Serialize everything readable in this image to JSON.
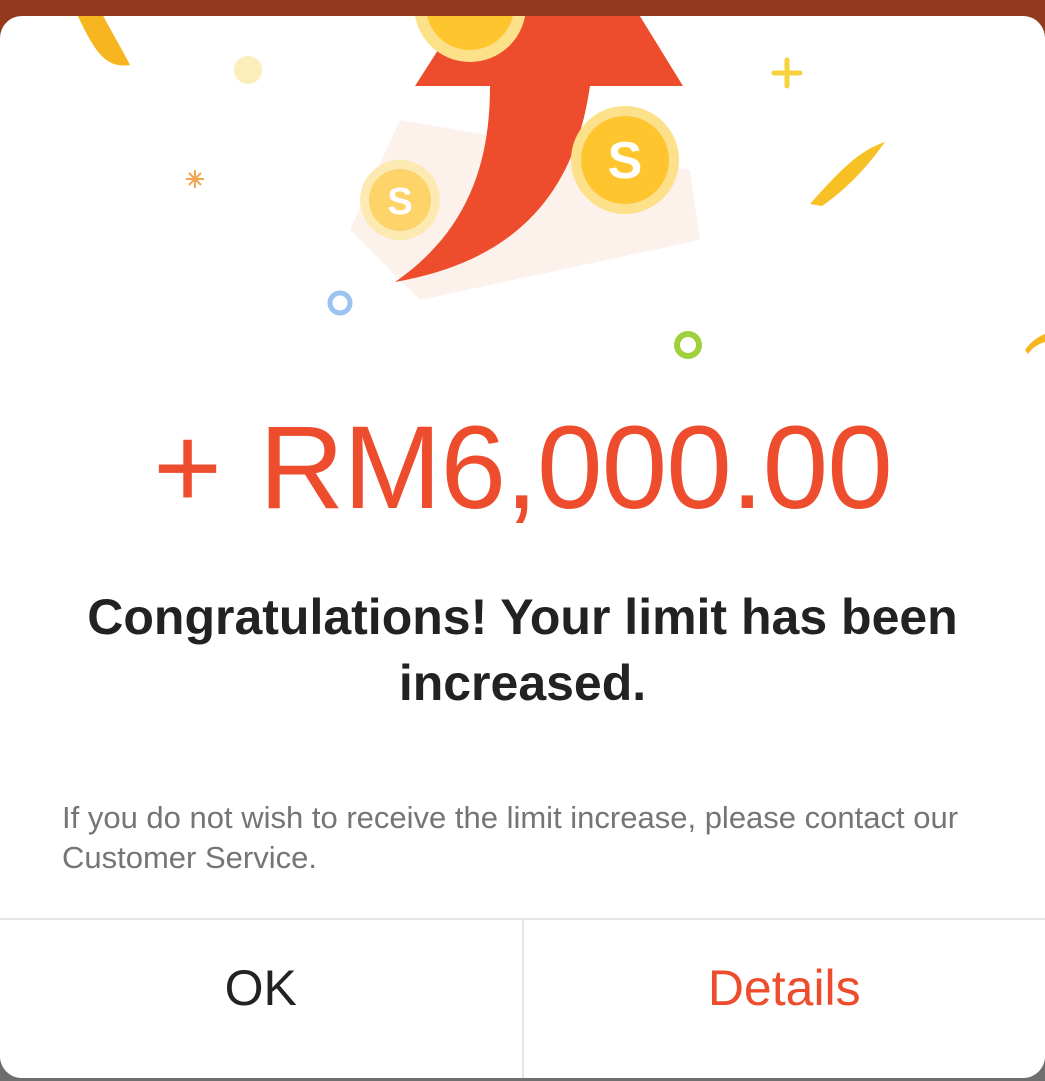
{
  "dialog": {
    "amount_sign": "+",
    "amount_value": "RM6,000.00",
    "headline": "Congratulations! Your limit has been increased.",
    "note": "If you do not wish to receive the limit increase, please contact our Customer Service.",
    "ok_label": "OK",
    "details_label": "Details"
  },
  "icons": {
    "illustration": "limit-increase-arrow-with-coins",
    "coin_symbol": "S"
  },
  "colors": {
    "accent": "#ee4d2d",
    "coin": "#ffc52e",
    "text_dark": "#222222",
    "text_muted": "#757575"
  }
}
